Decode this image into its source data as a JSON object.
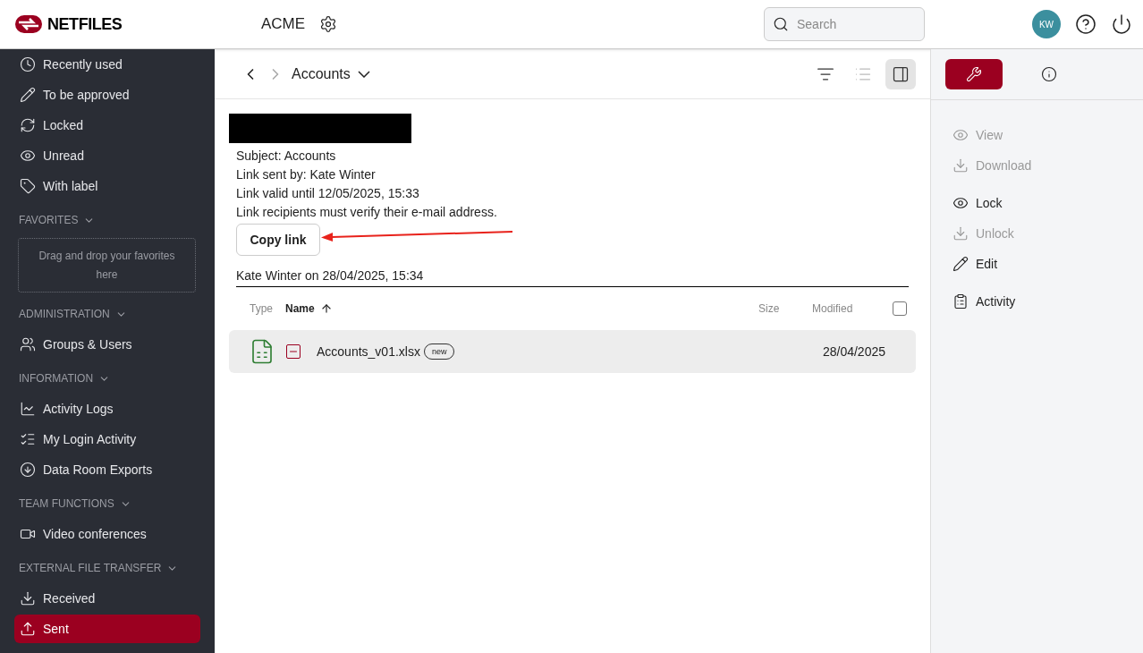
{
  "header": {
    "logo_text": "NETFILES",
    "workspace": "ACME",
    "search": {
      "placeholder": "Search"
    },
    "avatar": "KW"
  },
  "sidebar": {
    "items": [
      {
        "label": "Recently used",
        "selected": false
      },
      {
        "label": "To be approved",
        "selected": false
      },
      {
        "label": "Locked",
        "selected": false
      },
      {
        "label": "Unread",
        "selected": false
      },
      {
        "label": "With label",
        "selected": false
      }
    ],
    "sections": [
      {
        "title": "FAVORITES",
        "drop_hint": "Drag and drop your favorites here"
      },
      {
        "title": "ADMINISTRATION",
        "items": [
          {
            "label": "Groups & Users",
            "selected": false
          }
        ]
      },
      {
        "title": "INFORMATION",
        "items": [
          {
            "label": "Activity Logs",
            "selected": false
          },
          {
            "label": "My Login Activity",
            "selected": false
          },
          {
            "label": "Data Room Exports",
            "selected": false
          }
        ]
      },
      {
        "title": "TEAM FUNCTIONS",
        "items": [
          {
            "label": "Video conferences",
            "selected": false
          }
        ]
      },
      {
        "title": "EXTERNAL FILE TRANSFER",
        "items": [
          {
            "label": "Received",
            "selected": false
          },
          {
            "label": "Sent",
            "selected": true
          }
        ]
      }
    ]
  },
  "breadcrumb": {
    "current": "Accounts"
  },
  "view_buttons": [
    {
      "kind": "filter",
      "selected": false,
      "disabled": false
    },
    {
      "kind": "list",
      "selected": false,
      "disabled": true
    },
    {
      "kind": "panel",
      "selected": true,
      "disabled": false
    }
  ],
  "message": {
    "lines": [
      "Subject: Accounts",
      "Link sent by: Kate Winter",
      "Link valid until 12/05/2025, 15:33",
      "Link recipients must verify their e-mail address."
    ],
    "copy_button": "Copy link",
    "author_line": "Kate Winter on 28/04/2025, 15:34"
  },
  "table": {
    "columns": [
      {
        "label": "Type",
        "sorted": false
      },
      {
        "label": "Name",
        "sorted": true
      },
      {
        "label": "Size",
        "sorted": false
      },
      {
        "label": "Modified",
        "sorted": false
      }
    ],
    "select_all": {
      "checked": false
    },
    "rows": [
      {
        "name": "Accounts_v01.xlsx",
        "badge": "new",
        "modified": "28/04/2025"
      }
    ]
  },
  "right_panel": {
    "tabs": [
      {
        "kind": "tools",
        "selected": true
      },
      {
        "kind": "info",
        "selected": false
      }
    ],
    "actions": [
      {
        "label": "View",
        "disabled": true
      },
      {
        "label": "Download",
        "disabled": true
      },
      {
        "label": "Lock",
        "disabled": false
      },
      {
        "label": "Unlock",
        "disabled": true
      },
      {
        "label": "Edit",
        "disabled": false
      },
      {
        "label": "Activity",
        "disabled": false
      }
    ]
  }
}
